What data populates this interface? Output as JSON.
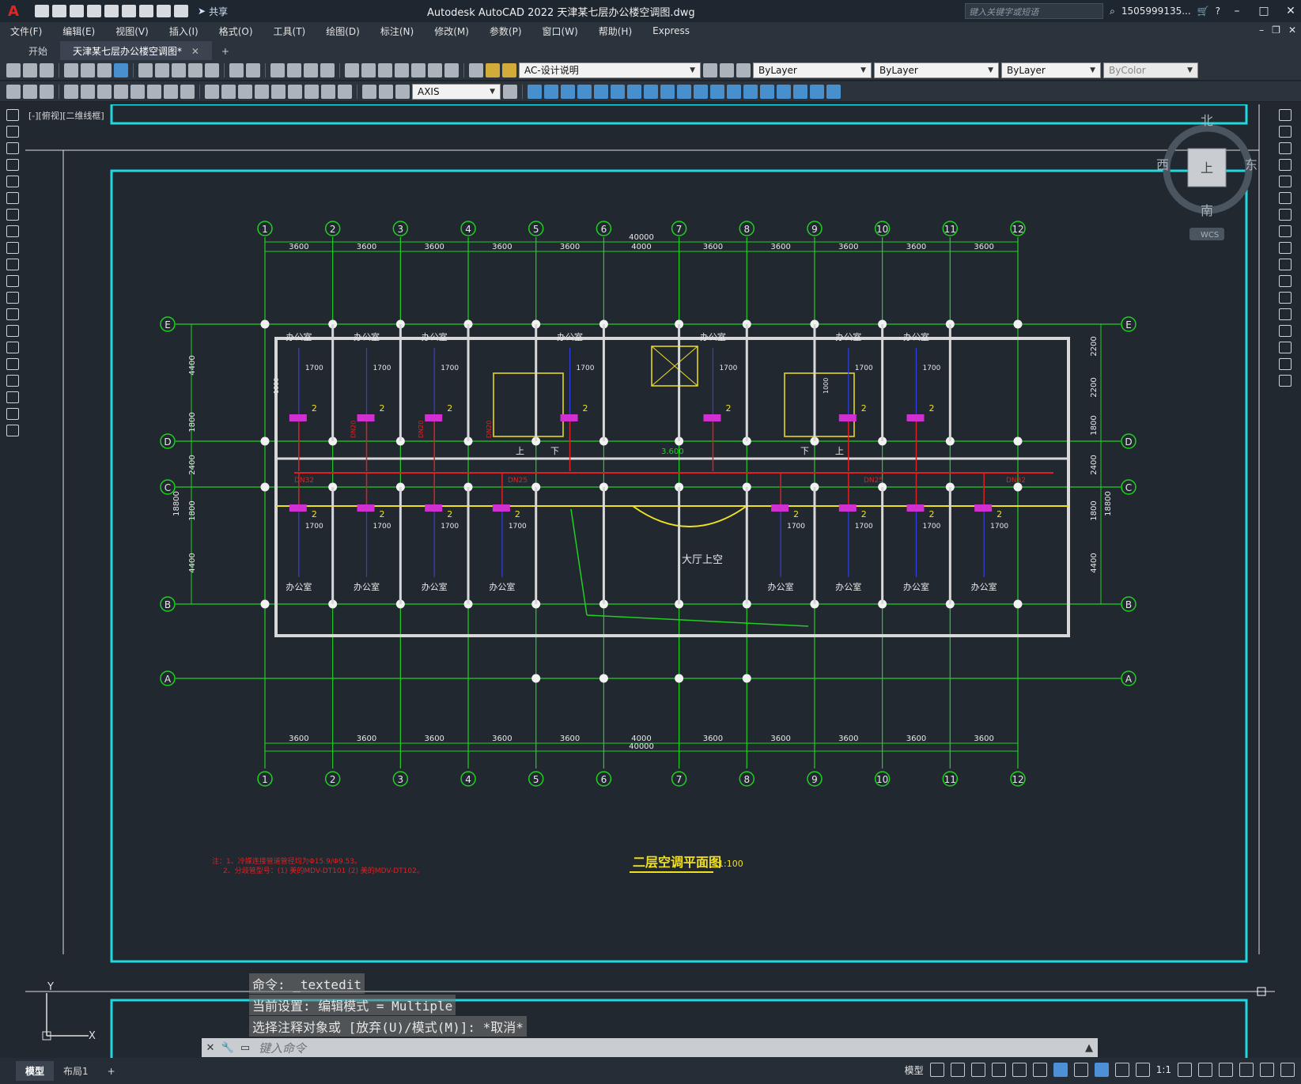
{
  "app": {
    "title": "Autodesk AutoCAD 2022    天津某七层办公楼空调图.dwg",
    "share_label": "共享",
    "search_placeholder": "键入关键字或短语",
    "user": "1505999135...",
    "logo": "A"
  },
  "menu": [
    "文件(F)",
    "编辑(E)",
    "视图(V)",
    "插入(I)",
    "格式(O)",
    "工具(T)",
    "绘图(D)",
    "标注(N)",
    "修改(M)",
    "参数(P)",
    "窗口(W)",
    "帮助(H)",
    "Express"
  ],
  "tabs": {
    "start": "开始",
    "active": "天津某七层办公楼空调图*"
  },
  "toolbar": {
    "layer": "AC-设计说明",
    "color": "ByLayer",
    "linetype": "ByLayer",
    "lineweight": "ByLayer",
    "plotstyle": "ByColor",
    "dimstyle": "AXIS"
  },
  "viewport_label": "[-][俯视][二维线框]",
  "viewcube": {
    "north": "北",
    "south": "南",
    "east": "东",
    "west": "西",
    "face": "上",
    "wcs": "WCS"
  },
  "drawing": {
    "grid_numbers": [
      "1",
      "2",
      "3",
      "4",
      "5",
      "6",
      "7",
      "8",
      "9",
      "10",
      "11",
      "12"
    ],
    "grid_letters": [
      "E",
      "D",
      "C",
      "B",
      "A"
    ],
    "bay_dims": [
      "3600",
      "3600",
      "3600",
      "3600",
      "3600",
      "4000",
      "3600",
      "3600",
      "3600",
      "3600",
      "3600"
    ],
    "total_width": "40000",
    "left_dims": [
      "4400",
      "1800",
      "2400",
      "1800",
      "4400"
    ],
    "total_depth": "18800",
    "right_dims": [
      "2200",
      "2200",
      "1800",
      "2400",
      "1800",
      "4400"
    ],
    "room_label": "办公室",
    "hall_label": "大厅上空",
    "stair_up": "上",
    "stair_down": "下",
    "unit_dim": "1700",
    "unit_dim2": "1000",
    "unit_tag": "2",
    "pipe_tags": [
      "DN32",
      "DN25",
      "DN20"
    ],
    "level": "3.600",
    "plan_title": "二层空调平面图",
    "plan_scale": "1:100",
    "note1": "注：1、冷媒连接管道管径均为Φ15.9/Φ9.53。",
    "note2": "2、分歧管型号：(1) 美的MDV-DT101  (2) 美的MDV-DT102。"
  },
  "command": {
    "history": [
      "命令:  _textedit",
      "当前设置: 编辑模式 = Multiple",
      "选择注释对象或 [放弃(U)/模式(M)]: *取消*"
    ],
    "placeholder": "键入命令"
  },
  "status": {
    "layouts": [
      "模型",
      "布局1"
    ],
    "model_label": "模型",
    "scale": "1:1"
  },
  "colors": {
    "grid": "#20d020",
    "wall": "#d8d8d8",
    "frame": "#22d8e0",
    "pipe": "#e02020",
    "unit": "#d030d0",
    "text_yellow": "#f0e020"
  }
}
